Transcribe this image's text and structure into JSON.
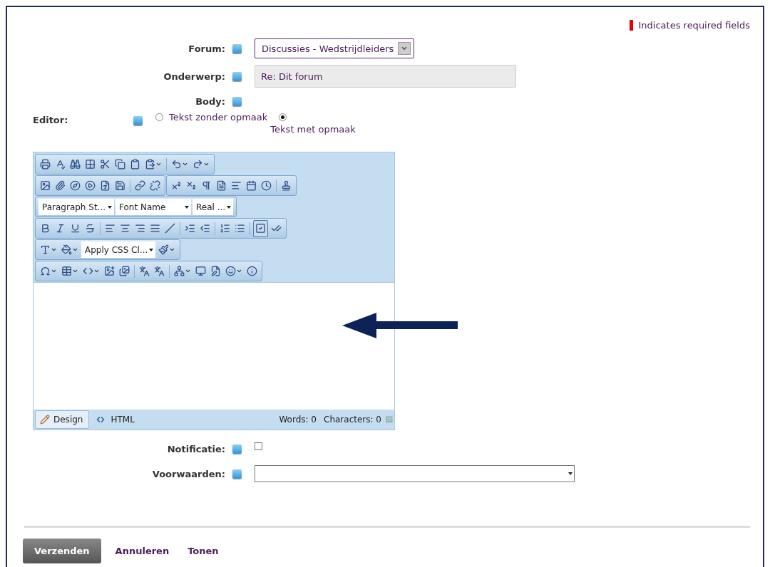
{
  "required_note": {
    "text": "Indicates required fields"
  },
  "forum": {
    "label": "Forum:",
    "value": "Discussies - Wedstrijdleiders"
  },
  "subject": {
    "label": "Onderwerp:",
    "value": "Re: Dit forum"
  },
  "body": {
    "label": "Body:"
  },
  "editor": {
    "label": "Editor:",
    "options": [
      {
        "label": "Tekst zonder opmaak",
        "selected": false
      },
      {
        "label": "Tekst met opmaak",
        "selected": true
      }
    ]
  },
  "rich_editor": {
    "dropdowns": [
      "Paragraph St...",
      "Font Name",
      "Real ...",
      "Apply CSS Cl..."
    ],
    "modes": [
      {
        "label": "Design",
        "selected": true
      },
      {
        "label": "HTML",
        "selected": false
      }
    ],
    "words": "Words: 0",
    "characters": "Characters: 0"
  },
  "notification": {
    "label": "Notificatie:",
    "checked": false
  },
  "terms": {
    "label": "Voorwaarden:"
  },
  "buttons": [
    {
      "label": "Verzenden",
      "kind": "primary"
    },
    {
      "label": "Annuleren",
      "kind": "link"
    },
    {
      "label": "Tonen",
      "kind": "link"
    }
  ]
}
